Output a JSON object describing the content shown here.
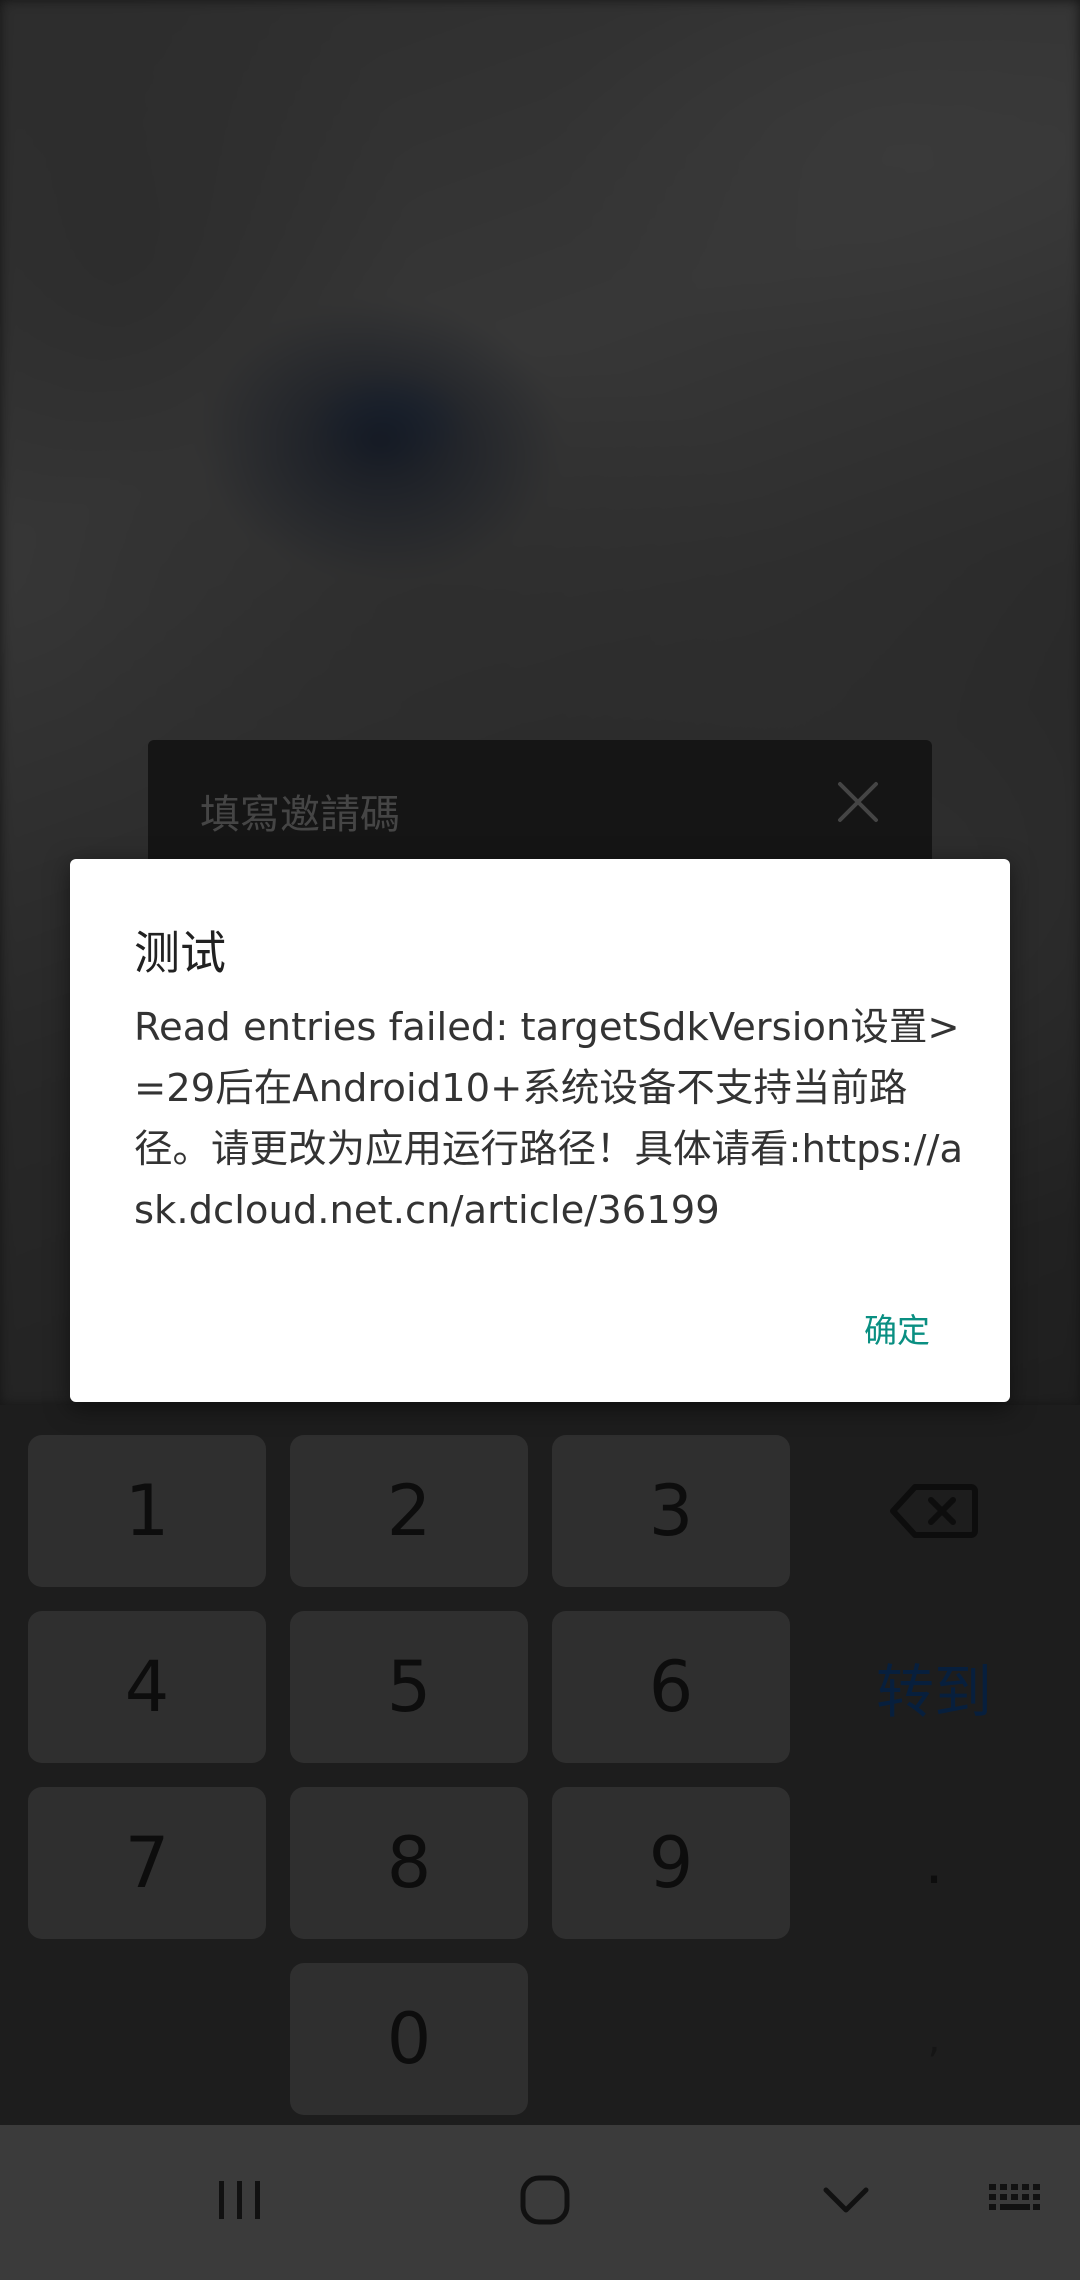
{
  "background": {
    "invite_title": "填寫邀請碼"
  },
  "dialog": {
    "title": "测试",
    "message": "Read entries failed: targetSdkVersion设置>=29后在Android10+系统设备不支持当前路径。请更改为应用运行路径！具体请看:https://ask.dcloud.net.cn/article/36199",
    "ok_label": "确定",
    "accent_color": "#0a8f82"
  },
  "keyboard": {
    "keys": [
      "1",
      "2",
      "3",
      "4",
      "5",
      "6",
      "7",
      "8",
      "9",
      "0"
    ],
    "goto_label": "转到",
    "dot_label": ".",
    "comma_label": ","
  },
  "navbar": {
    "icons": [
      "recent-apps-icon",
      "home-icon",
      "hide-keyboard-icon",
      "keyboard-switch-icon"
    ]
  }
}
